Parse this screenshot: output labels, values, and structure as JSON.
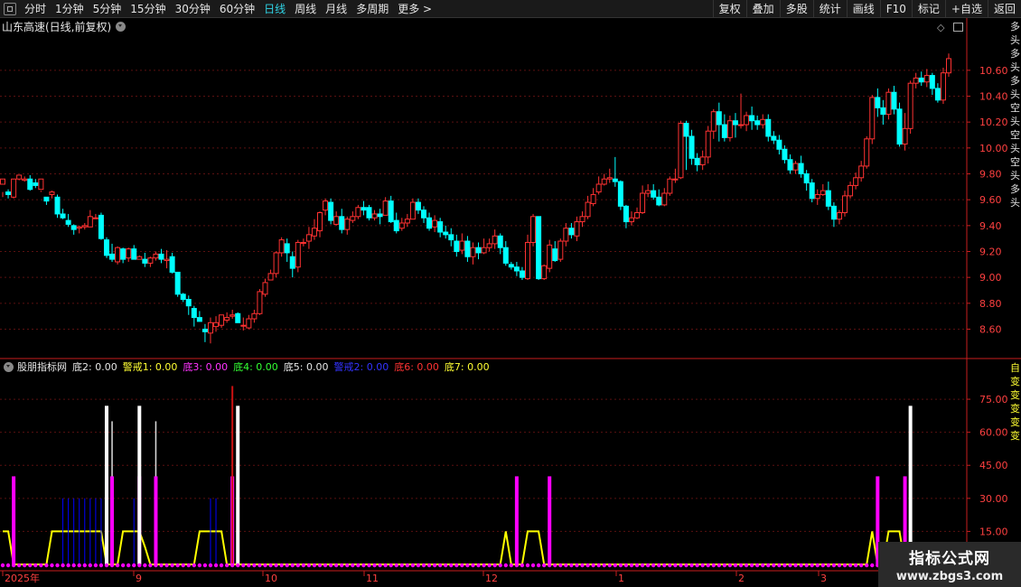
{
  "toolbar": {
    "left_items": [
      "分时",
      "1分钟",
      "5分钟",
      "15分钟",
      "30分钟",
      "60分钟",
      "日线",
      "周线",
      "月线",
      "多周期",
      "更多 >"
    ],
    "active": "日线",
    "right_items": [
      "复权",
      "叠加",
      "多股",
      "统计",
      "画线",
      "F10",
      "标记",
      "+自选",
      "返回"
    ]
  },
  "stock": {
    "title": "山东高速(日线,前复权)"
  },
  "price_axis": {
    "labels": [
      "10.60",
      "10.40",
      "10.20",
      "10.00",
      "9.80",
      "9.60",
      "9.40",
      "9.20",
      "9.00",
      "8.80",
      "8.60"
    ],
    "values": [
      10.6,
      10.4,
      10.2,
      10.0,
      9.8,
      9.6,
      9.4,
      9.2,
      9.0,
      8.8,
      8.6
    ]
  },
  "indicator": {
    "name": "股朋指标网",
    "items": [
      {
        "label": "底2: 0.00",
        "color": "#e6e6e6"
      },
      {
        "label": "警戒1: 0.00",
        "color": "#ffff33"
      },
      {
        "label": "底3: 0.00",
        "color": "#ff33ff"
      },
      {
        "label": "底4: 0.00",
        "color": "#33ff33"
      },
      {
        "label": "底5: 0.00",
        "color": "#e6e6e6"
      },
      {
        "label": "警戒2: 0.00",
        "color": "#3333ff"
      },
      {
        "label": "底6: 0.00",
        "color": "#ff3333"
      },
      {
        "label": "底7: 0.00",
        "color": "#ffff33"
      }
    ],
    "axis_labels": [
      "75.00",
      "60.00",
      "45.00",
      "30.00",
      "15.00"
    ],
    "axis_values": [
      75,
      60,
      45,
      30,
      15
    ]
  },
  "date_axis": {
    "labels": [
      "2025年",
      "9",
      "10",
      "11",
      "12",
      "1",
      "2",
      "3"
    ]
  },
  "right_side": {
    "top_text": "多头多头多头空头空头空头多头",
    "ind_text": "自变变变变变"
  },
  "watermark": {
    "title": "指标公式网",
    "url": "www.zbgs3.com"
  },
  "colors": {
    "up": "#ff3232",
    "down": "#00ffff",
    "grid": "#5a1010",
    "axis": "#c81e1e",
    "white_bar": "#ffffff",
    "magenta": "#ff00ff",
    "yellow": "#ffff00",
    "blue": "#0000ff",
    "dot": "#ff00ff"
  },
  "candles": [
    [
      9.72,
      9.76,
      9.66,
      9.62
    ],
    [
      9.66,
      9.64,
      9.68,
      9.61
    ],
    [
      9.62,
      9.76,
      9.61,
      9.62
    ],
    [
      9.76,
      9.79,
      9.75,
      9.76
    ],
    [
      9.75,
      9.76,
      9.78,
      9.74
    ],
    [
      9.76,
      9.68,
      9.79,
      9.67
    ],
    [
      9.73,
      9.71,
      9.76,
      9.69
    ],
    [
      9.68,
      9.76,
      9.67,
      9.66
    ],
    [
      9.62,
      9.59,
      9.62,
      9.56
    ],
    [
      9.64,
      9.66,
      9.67,
      9.61
    ],
    [
      9.62,
      9.49,
      9.64,
      9.46
    ],
    [
      9.49,
      9.46,
      9.53,
      9.45
    ],
    [
      9.44,
      9.41,
      9.49,
      9.39
    ],
    [
      9.4,
      9.37,
      9.41,
      9.33
    ],
    [
      9.38,
      9.39,
      9.4,
      9.34
    ],
    [
      9.39,
      9.4,
      9.42,
      9.37
    ],
    [
      9.39,
      9.47,
      9.52,
      9.39
    ],
    [
      9.46,
      9.46,
      9.49,
      9.46
    ],
    [
      9.48,
      9.3,
      9.5,
      9.29
    ],
    [
      9.29,
      9.17,
      9.31,
      9.15
    ],
    [
      9.18,
      9.14,
      9.26,
      9.12
    ],
    [
      9.12,
      9.23,
      9.24,
      9.1
    ],
    [
      9.22,
      9.14,
      9.23,
      9.11
    ],
    [
      9.15,
      9.22,
      9.23,
      9.12
    ],
    [
      9.22,
      9.14,
      9.25,
      9.14
    ],
    [
      9.14,
      9.16,
      9.17,
      9.14
    ],
    [
      9.14,
      9.11,
      9.19,
      9.08
    ],
    [
      9.11,
      9.15,
      9.16,
      9.08
    ],
    [
      9.15,
      9.18,
      9.2,
      9.13
    ],
    [
      9.18,
      9.14,
      9.22,
      9.11
    ],
    [
      9.13,
      9.14,
      9.21,
      9.07
    ],
    [
      9.16,
      9.04,
      9.19,
      9.03
    ],
    [
      9.04,
      8.87,
      9.04,
      8.85
    ],
    [
      8.87,
      8.83,
      8.88,
      8.81
    ],
    [
      8.83,
      8.78,
      8.86,
      8.71
    ],
    [
      8.76,
      8.69,
      8.78,
      8.62
    ],
    [
      8.69,
      8.66,
      8.74,
      8.67
    ],
    [
      8.6,
      8.58,
      8.64,
      8.5
    ],
    [
      8.57,
      8.65,
      8.69,
      8.49
    ],
    [
      8.62,
      8.65,
      8.7,
      8.58
    ],
    [
      8.63,
      8.71,
      8.71,
      8.61
    ],
    [
      8.67,
      8.69,
      8.73,
      8.65
    ],
    [
      8.7,
      8.71,
      8.75,
      8.68
    ],
    [
      8.72,
      8.65,
      8.73,
      8.65
    ],
    [
      8.63,
      8.63,
      8.69,
      8.59
    ],
    [
      8.61,
      8.68,
      8.71,
      8.6
    ],
    [
      8.68,
      8.72,
      8.75,
      8.65
    ],
    [
      8.72,
      8.89,
      8.91,
      8.71
    ],
    [
      8.87,
      8.96,
      8.99,
      8.85
    ],
    [
      8.98,
      9.03,
      9.06,
      8.98
    ],
    [
      9.03,
      9.19,
      9.2,
      9.0
    ],
    [
      9.19,
      9.29,
      9.31,
      9.16
    ],
    [
      9.26,
      9.19,
      9.3,
      9.12
    ],
    [
      9.16,
      9.07,
      9.2,
      9.0
    ],
    [
      9.08,
      9.27,
      9.29,
      9.04
    ],
    [
      9.27,
      9.27,
      9.3,
      9.24
    ],
    [
      9.28,
      9.33,
      9.39,
      9.22
    ],
    [
      9.32,
      9.38,
      9.45,
      9.29
    ],
    [
      9.36,
      9.5,
      9.51,
      9.31
    ],
    [
      9.52,
      9.59,
      9.61,
      9.48
    ],
    [
      9.58,
      9.44,
      9.61,
      9.41
    ],
    [
      9.41,
      9.47,
      9.51,
      9.4
    ],
    [
      9.47,
      9.37,
      9.53,
      9.34
    ],
    [
      9.37,
      9.45,
      9.47,
      9.33
    ],
    [
      9.44,
      9.47,
      9.51,
      9.42
    ],
    [
      9.47,
      9.54,
      9.56,
      9.45
    ],
    [
      9.54,
      9.52,
      9.59,
      9.48
    ],
    [
      9.54,
      9.46,
      9.56,
      9.44
    ],
    [
      9.46,
      9.49,
      9.52,
      9.44
    ],
    [
      9.49,
      9.47,
      9.53,
      9.41
    ],
    [
      9.48,
      9.59,
      9.62,
      9.48
    ],
    [
      9.59,
      9.43,
      9.63,
      9.42
    ],
    [
      9.44,
      9.36,
      9.5,
      9.34
    ],
    [
      9.38,
      9.42,
      9.46,
      9.36
    ],
    [
      9.42,
      9.45,
      9.49,
      9.39
    ],
    [
      9.45,
      9.58,
      9.61,
      9.45
    ],
    [
      9.58,
      9.52,
      9.61,
      9.49
    ],
    [
      9.52,
      9.46,
      9.55,
      9.42
    ],
    [
      9.46,
      9.38,
      9.5,
      9.36
    ],
    [
      9.39,
      9.44,
      9.48,
      9.35
    ],
    [
      9.43,
      9.35,
      9.46,
      9.31
    ],
    [
      9.35,
      9.33,
      9.4,
      9.3
    ],
    [
      9.33,
      9.29,
      9.38,
      9.24
    ],
    [
      9.28,
      9.2,
      9.33,
      9.16
    ],
    [
      9.21,
      9.28,
      9.34,
      9.18
    ],
    [
      9.28,
      9.16,
      9.32,
      9.12
    ],
    [
      9.16,
      9.23,
      9.27,
      9.1
    ],
    [
      9.23,
      9.19,
      9.27,
      9.14
    ],
    [
      9.19,
      9.23,
      9.3,
      9.18
    ],
    [
      9.23,
      9.26,
      9.3,
      9.2
    ],
    [
      9.26,
      9.32,
      9.37,
      9.22
    ],
    [
      9.32,
      9.23,
      9.34,
      9.18
    ],
    [
      9.23,
      9.11,
      9.28,
      9.09
    ],
    [
      9.1,
      9.08,
      9.12,
      9.06
    ],
    [
      9.08,
      9.05,
      9.12,
      9.01
    ],
    [
      9.05,
      9.0,
      9.08,
      8.98
    ],
    [
      8.99,
      9.27,
      9.33,
      8.98
    ],
    [
      9.27,
      9.47,
      9.49,
      9.24
    ],
    [
      9.47,
      8.99,
      9.47,
      8.98
    ],
    [
      8.99,
      9.09,
      9.1,
      8.98
    ],
    [
      9.07,
      9.25,
      9.29,
      9.04
    ],
    [
      9.22,
      9.13,
      9.28,
      9.12
    ],
    [
      9.14,
      9.28,
      9.3,
      9.12
    ],
    [
      9.28,
      9.38,
      9.42,
      9.24
    ],
    [
      9.38,
      9.33,
      9.42,
      9.3
    ],
    [
      9.32,
      9.43,
      9.47,
      9.28
    ],
    [
      9.43,
      9.47,
      9.51,
      9.39
    ],
    [
      9.47,
      9.58,
      9.63,
      9.45
    ],
    [
      9.57,
      9.64,
      9.69,
      9.55
    ],
    [
      9.66,
      9.72,
      9.78,
      9.64
    ],
    [
      9.72,
      9.76,
      9.8,
      9.71
    ],
    [
      9.76,
      9.77,
      9.84,
      9.73
    ],
    [
      9.76,
      9.74,
      9.93,
      9.7
    ],
    [
      9.74,
      9.55,
      9.75,
      9.52
    ],
    [
      9.55,
      9.43,
      9.56,
      9.38
    ],
    [
      9.43,
      9.46,
      9.51,
      9.4
    ],
    [
      9.46,
      9.5,
      9.54,
      9.45
    ],
    [
      9.5,
      9.65,
      9.71,
      9.49
    ],
    [
      9.65,
      9.67,
      9.72,
      9.62
    ],
    [
      9.67,
      9.62,
      9.72,
      9.6
    ],
    [
      9.62,
      9.56,
      9.68,
      9.55
    ],
    [
      9.56,
      9.65,
      9.69,
      9.55
    ],
    [
      9.65,
      9.76,
      9.78,
      9.63
    ],
    [
      9.76,
      9.76,
      9.84,
      9.73
    ],
    [
      9.77,
      10.19,
      10.21,
      9.76
    ],
    [
      10.19,
      10.09,
      10.21,
      9.83
    ],
    [
      10.09,
      9.92,
      10.14,
      9.87
    ],
    [
      9.92,
      9.87,
      9.96,
      9.82
    ],
    [
      9.87,
      9.93,
      9.98,
      9.83
    ],
    [
      9.93,
      10.13,
      10.17,
      9.88
    ],
    [
      10.13,
      10.28,
      10.3,
      10.07
    ],
    [
      10.28,
      10.18,
      10.35,
      10.05
    ],
    [
      10.18,
      10.08,
      10.26,
      10.05
    ],
    [
      10.08,
      10.21,
      10.25,
      10.05
    ],
    [
      10.21,
      10.18,
      10.27,
      10.08
    ],
    [
      10.18,
      10.18,
      10.42,
      10.15
    ],
    [
      10.18,
      10.25,
      10.28,
      10.13
    ],
    [
      10.25,
      10.21,
      10.32,
      10.14
    ],
    [
      10.21,
      10.18,
      10.25,
      10.14
    ],
    [
      10.18,
      10.22,
      10.26,
      10.15
    ],
    [
      10.22,
      10.09,
      10.26,
      10.05
    ],
    [
      10.09,
      10.06,
      10.13,
      10.03
    ],
    [
      10.06,
      9.99,
      10.1,
      9.95
    ],
    [
      9.99,
      9.91,
      10.02,
      9.88
    ],
    [
      9.91,
      9.83,
      9.95,
      9.8
    ],
    [
      9.83,
      9.88,
      9.9,
      9.8
    ],
    [
      9.88,
      9.8,
      9.94,
      9.77
    ],
    [
      9.8,
      9.73,
      9.83,
      9.67
    ],
    [
      9.73,
      9.61,
      9.76,
      9.58
    ],
    [
      9.61,
      9.64,
      9.68,
      9.56
    ],
    [
      9.64,
      9.67,
      9.72,
      9.63
    ],
    [
      9.67,
      9.55,
      9.74,
      9.52
    ],
    [
      9.55,
      9.45,
      9.58,
      9.39
    ],
    [
      9.45,
      9.5,
      9.52,
      9.41
    ],
    [
      9.5,
      9.63,
      9.67,
      9.47
    ],
    [
      9.63,
      9.71,
      9.74,
      9.61
    ],
    [
      9.71,
      9.77,
      9.81,
      9.68
    ],
    [
      9.77,
      9.86,
      9.9,
      9.74
    ],
    [
      9.86,
      10.07,
      10.09,
      9.84
    ],
    [
      10.07,
      10.39,
      10.41,
      10.03
    ],
    [
      10.39,
      10.31,
      10.46,
      10.24
    ],
    [
      10.31,
      10.26,
      10.37,
      10.18
    ],
    [
      10.26,
      10.43,
      10.46,
      10.22
    ],
    [
      10.43,
      10.3,
      10.48,
      10.26
    ],
    [
      10.3,
      10.03,
      10.35,
      10.01
    ],
    [
      10.03,
      10.15,
      10.27,
      9.98
    ],
    [
      10.15,
      10.5,
      10.52,
      10.11
    ],
    [
      10.5,
      10.54,
      10.58,
      10.46
    ],
    [
      10.54,
      10.51,
      10.59,
      10.48
    ],
    [
      10.51,
      10.56,
      10.61,
      10.47
    ],
    [
      10.56,
      10.46,
      10.58,
      10.41
    ],
    [
      10.46,
      10.37,
      10.5,
      10.35
    ],
    [
      10.37,
      10.58,
      10.62,
      10.34
    ],
    [
      10.58,
      10.69,
      10.73,
      10.55
    ]
  ],
  "ind_bars": {
    "white": [
      {
        "i": 19,
        "h": 72
      },
      {
        "i": 25,
        "h": 72
      },
      {
        "i": 43,
        "h": 72
      },
      {
        "i": 166,
        "h": 72
      }
    ],
    "white_thin": [
      {
        "i": 20,
        "h": 65
      },
      {
        "i": 28,
        "h": 65
      },
      {
        "i": 42,
        "h": 62
      }
    ],
    "magenta": [
      {
        "i": 2,
        "h": 40
      },
      {
        "i": 20,
        "h": 40
      },
      {
        "i": 25,
        "h": 40
      },
      {
        "i": 28,
        "h": 40
      },
      {
        "i": 42,
        "h": 40
      },
      {
        "i": 94,
        "h": 40
      },
      {
        "i": 100,
        "h": 40
      },
      {
        "i": 160,
        "h": 40
      },
      {
        "i": 165,
        "h": 40
      }
    ],
    "red": [
      {
        "i": 42,
        "h": 81
      }
    ],
    "blue": [
      {
        "i": 11,
        "h": 30
      },
      {
        "i": 12,
        "h": 30
      },
      {
        "i": 13,
        "h": 30
      },
      {
        "i": 14,
        "h": 30
      },
      {
        "i": 15,
        "h": 30
      },
      {
        "i": 16,
        "h": 30
      },
      {
        "i": 17,
        "h": 30
      },
      {
        "i": 18,
        "h": 30
      },
      {
        "i": 24,
        "h": 30
      },
      {
        "i": 38,
        "h": 30
      },
      {
        "i": 39,
        "h": 30
      }
    ]
  },
  "yellow_line": [
    15,
    15,
    0,
    0,
    0,
    0,
    0,
    0,
    0,
    15,
    15,
    15,
    15,
    15,
    15,
    15,
    15,
    15,
    15,
    0,
    0,
    0,
    15,
    15,
    15,
    15,
    8,
    0,
    0,
    0,
    0,
    0,
    0,
    0,
    0,
    0,
    15,
    15,
    15,
    15,
    15,
    0,
    0,
    0,
    0,
    0,
    0,
    0,
    0,
    0,
    0,
    0,
    0,
    0,
    0,
    0,
    0,
    0,
    0,
    0,
    0,
    0,
    0,
    0,
    0,
    0,
    0,
    0,
    0,
    0,
    0,
    0,
    0,
    0,
    0,
    0,
    0,
    0,
    0,
    0,
    0,
    0,
    0,
    0,
    0,
    0,
    0,
    0,
    0,
    0,
    0,
    0,
    15,
    0,
    0,
    0,
    15,
    15,
    15,
    0,
    0,
    0,
    0,
    0,
    0,
    0,
    0,
    0,
    0,
    0,
    0,
    0,
    0,
    0,
    0,
    0,
    0,
    0,
    0,
    0,
    0,
    0,
    0,
    0,
    0,
    0,
    0,
    0,
    0,
    0,
    0,
    0,
    0,
    0,
    0,
    0,
    0,
    0,
    0,
    0,
    0,
    0,
    0,
    0,
    0,
    0,
    0,
    0,
    0,
    0,
    0,
    0,
    0,
    0,
    0,
    0,
    0,
    0,
    0,
    15,
    0,
    0,
    15,
    15,
    15,
    0,
    0,
    0,
    0,
    0,
    0,
    0,
    0,
    0,
    0,
    0,
    0,
    0,
    0,
    0,
    0,
    0,
    0
  ]
}
